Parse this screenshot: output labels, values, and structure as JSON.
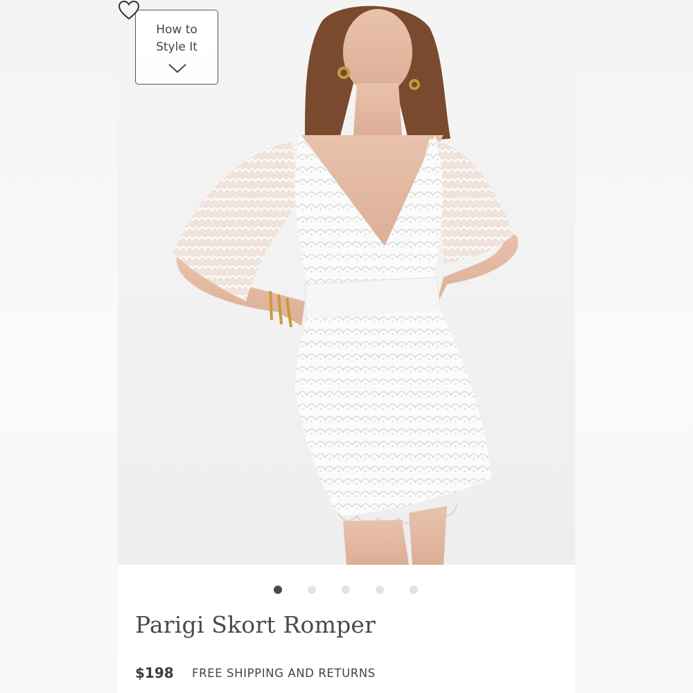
{
  "style_guide": {
    "line1": "How to",
    "line2": "Style It",
    "icon": "chevron-down-icon"
  },
  "wishlist": {
    "icon": "heart-outline-icon"
  },
  "carousel": {
    "total": 5,
    "active_index": 0
  },
  "product": {
    "name": "Parigi Skort Romper",
    "price": "$198",
    "shipping": "FREE SHIPPING AND RETURNS"
  },
  "colors": {
    "dot_active": "#4a4a4a",
    "dot_inactive": "#e3e3e3",
    "text": "#4a4a4a"
  }
}
